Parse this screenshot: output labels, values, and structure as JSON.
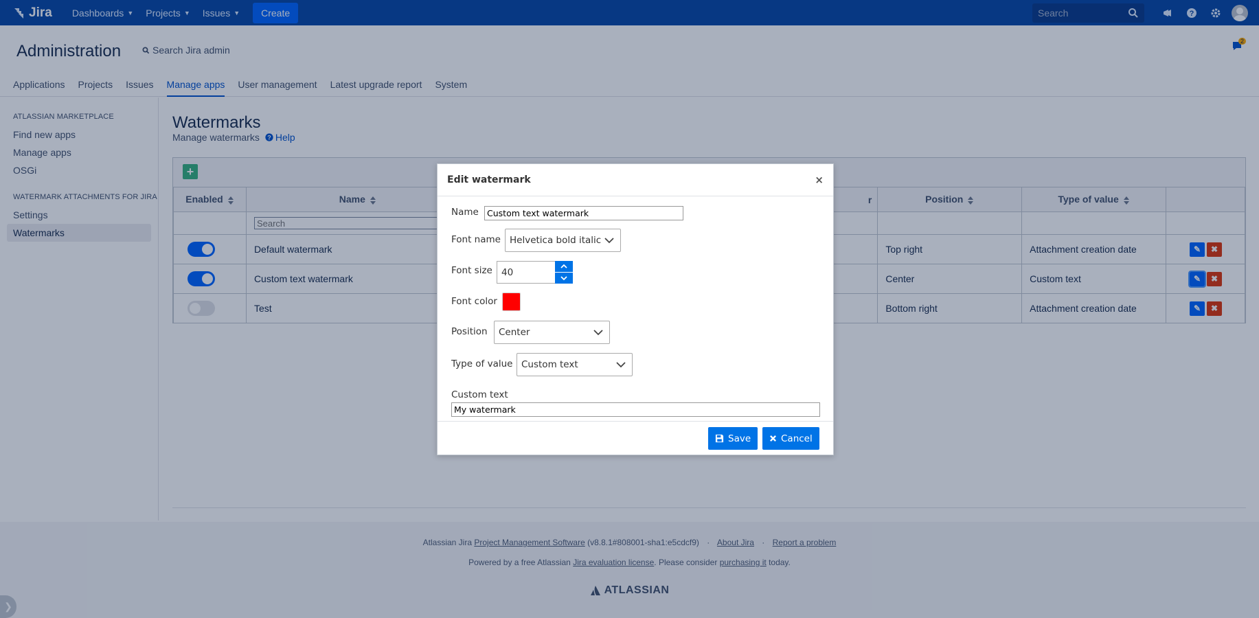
{
  "topnav": {
    "product": "Jira",
    "menu": [
      "Dashboards",
      "Projects",
      "Issues"
    ],
    "create_label": "Create",
    "search_placeholder": "Search"
  },
  "admin": {
    "title": "Administration",
    "search_label": "Search Jira admin",
    "notification_count": "2",
    "tabs": [
      "Applications",
      "Projects",
      "Issues",
      "Manage apps",
      "User management",
      "Latest upgrade report",
      "System"
    ],
    "active_tab": "Manage apps"
  },
  "sidebar": {
    "section1": "ATLASSIAN MARKETPLACE",
    "items1": [
      "Find new apps",
      "Manage apps",
      "OSGi"
    ],
    "section2": "WATERMARK ATTACHMENTS FOR JIRA",
    "items2": [
      "Settings",
      "Watermarks"
    ],
    "active": "Watermarks"
  },
  "main": {
    "title": "Watermarks",
    "subtitle": "Manage watermarks",
    "help_label": "Help"
  },
  "table": {
    "headers": {
      "enabled": "Enabled",
      "name": "Name",
      "color_partial": "r",
      "position": "Position",
      "type_of_value": "Type of value"
    },
    "filter_placeholder": "Search",
    "rows": [
      {
        "enabled": true,
        "name": "Default watermark",
        "position": "Top right",
        "type_of_value": "Attachment creation date"
      },
      {
        "enabled": true,
        "name": "Custom text watermark",
        "position": "Center",
        "type_of_value": "Custom text"
      },
      {
        "enabled": false,
        "name": "Test",
        "position": "Bottom right",
        "type_of_value": "Attachment creation date"
      }
    ]
  },
  "footer": {
    "line1_prefix": "Atlassian Jira",
    "line1_link": "Project Management Software",
    "line1_version": "(v8.8.1#808001-sha1:e5cdcf9)",
    "about": "About Jira",
    "report": "Report a problem",
    "line2_a": "Powered by a free Atlassian",
    "line2_link1": "Jira evaluation license",
    "line2_b": ". Please consider",
    "line2_link2": "purchasing it",
    "line2_c": "today.",
    "brand": "ATLASSIAN"
  },
  "dialog": {
    "title": "Edit watermark",
    "close": "×",
    "name_label": "Name",
    "name_value": "Custom text watermark",
    "font_name_label": "Font name",
    "font_name_value": "Helvetica bold italic",
    "font_size_label": "Font size",
    "font_size_value": "40",
    "font_color_label": "Font color",
    "font_color_value": "#ff0000",
    "position_label": "Position",
    "position_value": "Center",
    "type_label": "Type of value",
    "type_value": "Custom text",
    "custom_text_label": "Custom text",
    "custom_text_value": "My watermark",
    "save_label": "Save",
    "cancel_label": "Cancel"
  }
}
